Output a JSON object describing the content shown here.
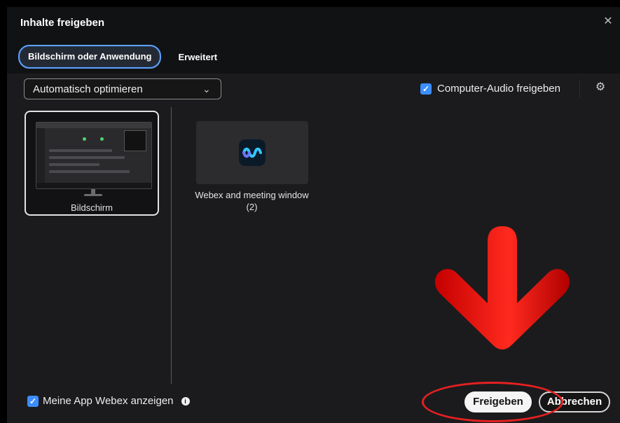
{
  "window": {
    "title": "Inhalte freigeben"
  },
  "tabs": [
    {
      "label": "Bildschirm oder Anwendung",
      "active": true
    },
    {
      "label": "Erweitert",
      "active": false
    }
  ],
  "toolbar": {
    "optimization_select": {
      "value": "Automatisch optimieren"
    },
    "audio": {
      "label": "Computer-Audio freigeben",
      "checked": true
    }
  },
  "sources": {
    "screen": {
      "label": "Bildschirm",
      "selected": true
    },
    "app": {
      "label_line1": "Webex and meeting window",
      "label_line2": "(2)"
    }
  },
  "footer": {
    "show_app_label": "Meine App Webex anzeigen",
    "show_app_checked": true,
    "share_button": "Freigeben",
    "cancel_button": "Abbrechen"
  },
  "icons": {
    "close": "close-icon",
    "chevron": "chevron-down-icon",
    "checkbox": "checkbox-icon",
    "settings": "gear-icon",
    "webex": "webex-icon",
    "info": "info-icon"
  },
  "colors": {
    "accent": "#3c8dff",
    "annotation": "#e52020",
    "background": "#111214",
    "content": "#1b1b1d"
  }
}
